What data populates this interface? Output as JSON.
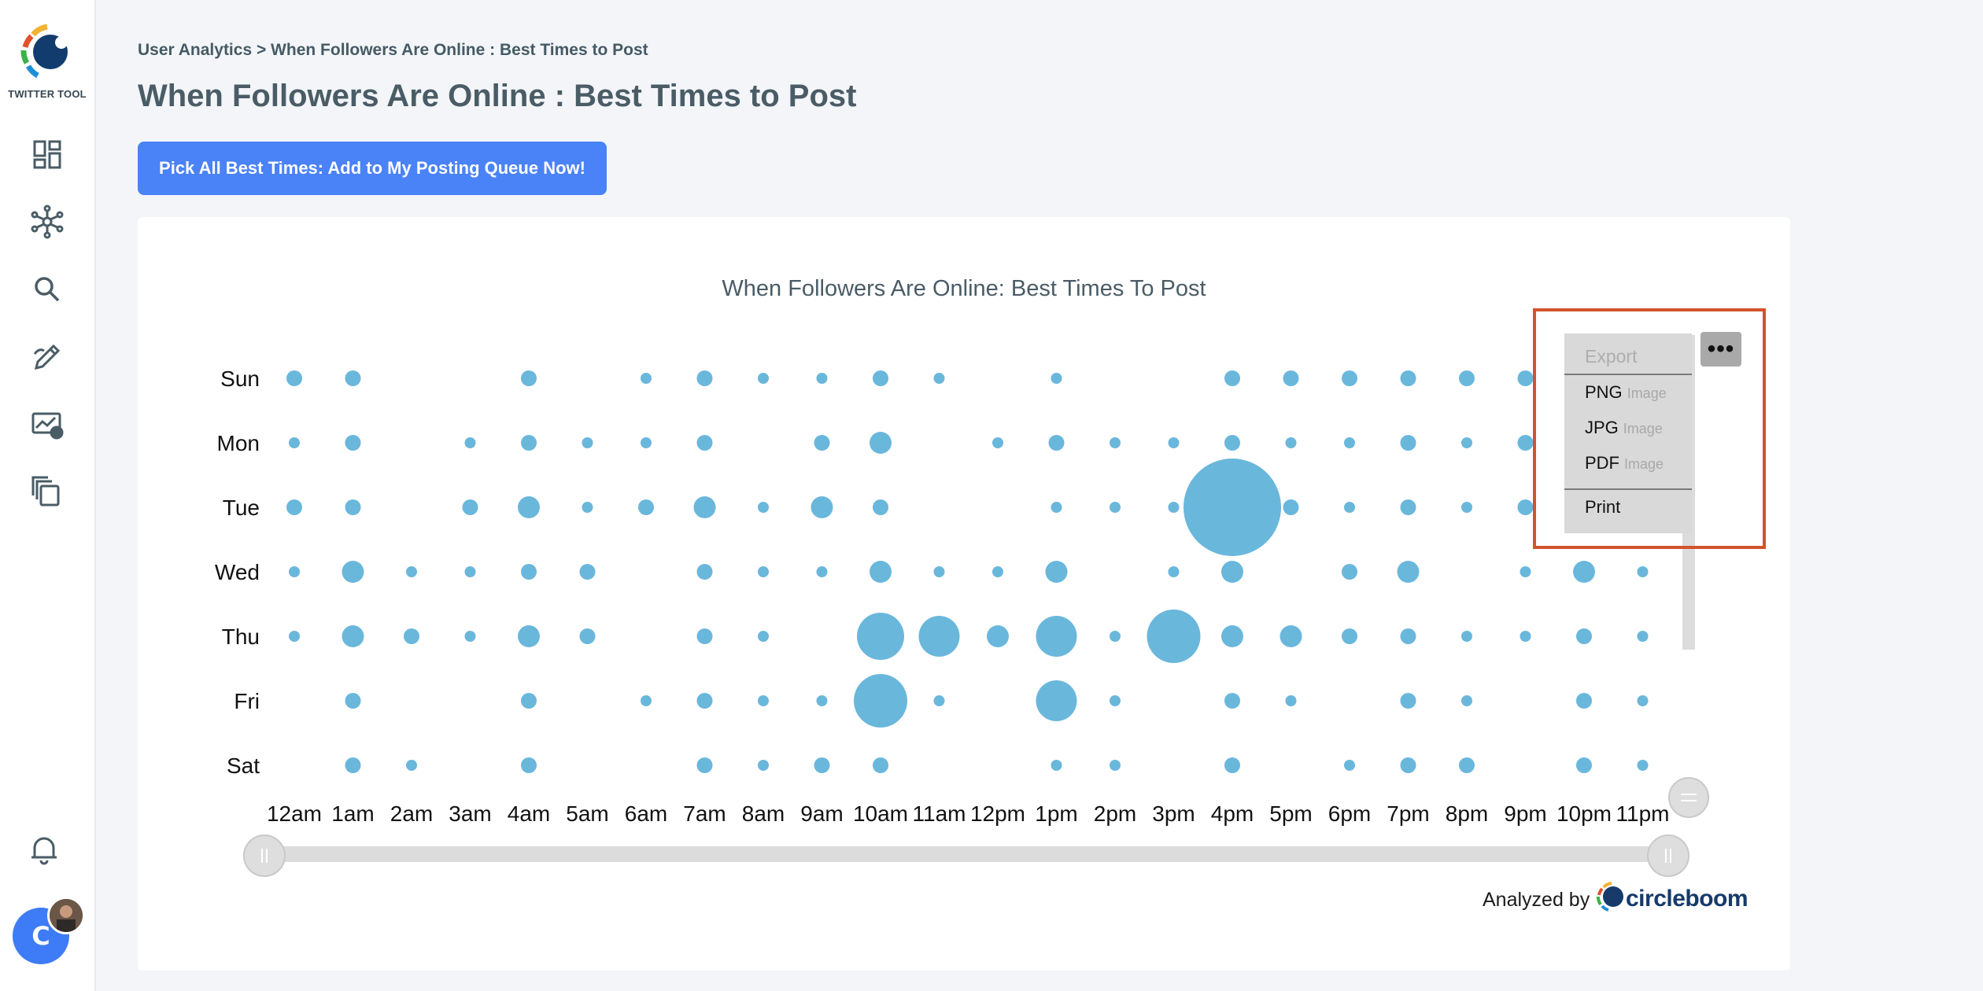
{
  "sidebar": {
    "logo_text": "TWITTER TOOL",
    "items": [
      {
        "icon": "dashboard-icon"
      },
      {
        "icon": "network-icon"
      },
      {
        "icon": "search-icon"
      },
      {
        "icon": "edit-icon"
      },
      {
        "icon": "analytics-icon"
      },
      {
        "icon": "copy-icon"
      }
    ],
    "notifications_icon": "bell-icon",
    "avatar_letter": "C"
  },
  "header": {
    "breadcrumb": "User Analytics > When Followers Are Online : Best Times to Post",
    "title": "When Followers Are Online : Best Times to Post",
    "action_button": "Pick All Best Times: Add to My Posting Queue Now!"
  },
  "export_menu": {
    "header": "Export",
    "items": [
      {
        "label": "PNG",
        "sub": "Image"
      },
      {
        "label": "JPG",
        "sub": "Image"
      },
      {
        "label": "PDF",
        "sub": "Image"
      },
      {
        "label": "Print",
        "sub": ""
      }
    ]
  },
  "footer": {
    "analyzed_by": "Analyzed by",
    "brand": "circleboom"
  },
  "colors": {
    "accent": "#4a82f7",
    "bubble": "#6ab7dc",
    "highlight": "#d2532c"
  },
  "chart_data": {
    "type": "scatter",
    "title": "When Followers Are Online: Best Times To Post",
    "x": [
      "12am",
      "1am",
      "2am",
      "3am",
      "4am",
      "5am",
      "6am",
      "7am",
      "8am",
      "9am",
      "10am",
      "11am",
      "12pm",
      "1pm",
      "2pm",
      "3pm",
      "4pm",
      "5pm",
      "6pm",
      "7pm",
      "8pm",
      "9pm",
      "10pm",
      "11pm"
    ],
    "y": [
      "Sun",
      "Mon",
      "Tue",
      "Wed",
      "Thu",
      "Fri",
      "Sat"
    ],
    "size_note": "activity level 0-10 shown as bubble size",
    "values": [
      [
        2,
        2,
        0,
        0,
        2,
        0,
        1,
        2,
        1,
        1,
        2,
        1,
        0,
        1,
        0,
        0,
        2,
        2,
        2,
        2,
        2,
        2,
        0,
        0
      ],
      [
        1,
        2,
        0,
        1,
        2,
        1,
        1,
        2,
        0,
        2,
        3,
        0,
        1,
        2,
        1,
        1,
        2,
        1,
        1,
        2,
        1,
        2,
        0,
        0
      ],
      [
        2,
        2,
        0,
        2,
        3,
        1,
        2,
        3,
        1,
        3,
        2,
        0,
        0,
        1,
        1,
        1,
        10,
        2,
        1,
        2,
        1,
        2,
        0,
        0
      ],
      [
        1,
        3,
        1,
        1,
        2,
        2,
        0,
        2,
        1,
        1,
        3,
        1,
        1,
        3,
        0,
        1,
        3,
        0,
        2,
        3,
        0,
        1,
        3,
        1
      ],
      [
        1,
        3,
        2,
        1,
        3,
        2,
        0,
        2,
        1,
        0,
        5,
        4,
        3,
        4,
        1,
        6,
        3,
        3,
        2,
        2,
        1,
        1,
        2,
        1
      ],
      [
        0,
        2,
        0,
        0,
        2,
        0,
        1,
        2,
        1,
        1,
        6,
        1,
        0,
        4,
        1,
        0,
        2,
        1,
        0,
        2,
        1,
        0,
        2,
        1
      ],
      [
        0,
        2,
        1,
        0,
        2,
        0,
        0,
        2,
        1,
        2,
        2,
        0,
        0,
        1,
        1,
        0,
        2,
        0,
        1,
        2,
        2,
        0,
        2,
        1
      ]
    ]
  }
}
